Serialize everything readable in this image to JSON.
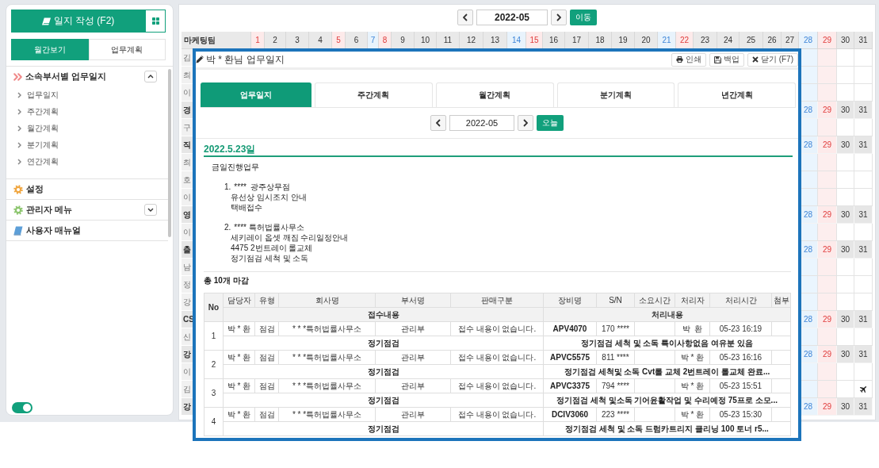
{
  "sidebar": {
    "write_button": {
      "label": "일지 작성 (F2)"
    },
    "view_tabs": [
      {
        "label": "월간보기",
        "selected": true
      },
      {
        "label": "업무계획",
        "selected": false
      }
    ],
    "menu": [
      {
        "kind": "journal",
        "label": "소속부서별 업무일지",
        "expanded": true,
        "children": [
          {
            "label": "업무일지"
          },
          {
            "label": "주간계획"
          },
          {
            "label": "월간계획"
          },
          {
            "label": "분기계획"
          },
          {
            "label": "연간계획"
          }
        ]
      },
      {
        "kind": "settings",
        "label": "설정"
      },
      {
        "kind": "admin",
        "label": "관리자 메뉴",
        "expanded": false
      },
      {
        "kind": "manual",
        "label": "사용자 매뉴얼"
      }
    ],
    "toggle": {
      "on": true
    }
  },
  "calendar": {
    "month": "2022-05",
    "go_button": "이동",
    "team": "마케팅팀",
    "days": [
      {
        "label": "1",
        "kind": "holiday"
      },
      {
        "label": "2",
        "kind": "weekday"
      },
      {
        "label": "3",
        "kind": "weekday"
      },
      {
        "label": "4",
        "kind": "weekday"
      },
      {
        "label": "5",
        "kind": "holiday"
      },
      {
        "label": "6",
        "kind": "weekday"
      },
      {
        "label": "7",
        "kind": "saturday"
      },
      {
        "label": "8",
        "kind": "holiday"
      },
      {
        "label": "9",
        "kind": "weekday"
      },
      {
        "label": "10",
        "kind": "weekday"
      },
      {
        "label": "11",
        "kind": "weekday"
      },
      {
        "label": "12",
        "kind": "weekday"
      },
      {
        "label": "13",
        "kind": "weekday"
      },
      {
        "label": "14",
        "kind": "saturday"
      },
      {
        "label": "15",
        "kind": "holiday"
      },
      {
        "label": "16",
        "kind": "weekday"
      },
      {
        "label": "17",
        "kind": "weekday"
      },
      {
        "label": "18",
        "kind": "weekday"
      },
      {
        "label": "19",
        "kind": "weekday"
      },
      {
        "label": "20",
        "kind": "weekday"
      },
      {
        "label": "21",
        "kind": "saturday"
      },
      {
        "label": "22",
        "kind": "holiday"
      },
      {
        "label": "23",
        "kind": "weekday"
      },
      {
        "label": "24",
        "kind": "weekday"
      },
      {
        "label": "25",
        "kind": "weekday"
      },
      {
        "label": "26",
        "kind": "weekday"
      },
      {
        "label": "27",
        "kind": "weekday"
      },
      {
        "label": "28",
        "kind": "saturday"
      },
      {
        "label": "29",
        "kind": "holiday"
      },
      {
        "label": "30",
        "kind": "weekday"
      },
      {
        "label": "31",
        "kind": "weekday"
      }
    ],
    "rows": [
      {
        "name": "김",
        "kind": "member",
        "cells": [
          {
            "trip": false
          },
          {
            "trip": false
          },
          {
            "trip": false
          },
          {
            "trip": false
          }
        ]
      },
      {
        "name": "최",
        "kind": "member",
        "cells": [
          {
            "trip": false
          },
          {
            "trip": false
          },
          {
            "trip": false
          },
          {
            "trip": false
          }
        ]
      },
      {
        "name": "이",
        "kind": "member",
        "cells": [
          {
            "trip": false
          },
          {
            "trip": false
          },
          {
            "trip": false
          },
          {
            "trip": false
          }
        ]
      },
      {
        "name": "경",
        "kind": "team",
        "cells": [
          {
            "text": "28"
          },
          {
            "text": "29"
          },
          {
            "text": "30"
          },
          {
            "text": "31"
          }
        ]
      },
      {
        "name": "구",
        "kind": "member",
        "cells": [
          {
            "trip": false
          },
          {
            "trip": false
          },
          {
            "trip": false
          },
          {
            "trip": false
          }
        ]
      },
      {
        "name": "직",
        "kind": "team",
        "cells": [
          {
            "text": "28"
          },
          {
            "text": "29"
          },
          {
            "text": "30"
          },
          {
            "text": "31"
          }
        ]
      },
      {
        "name": "최",
        "kind": "member",
        "cells": [
          {
            "trip": false
          },
          {
            "trip": false
          },
          {
            "trip": false
          },
          {
            "trip": false
          }
        ]
      },
      {
        "name": "호",
        "kind": "member",
        "cells": [
          {
            "trip": false
          },
          {
            "trip": false
          },
          {
            "trip": false
          },
          {
            "trip": false
          }
        ]
      },
      {
        "name": "이",
        "kind": "member",
        "cells": [
          {
            "trip": false
          },
          {
            "trip": false
          },
          {
            "trip": false
          },
          {
            "trip": false
          }
        ]
      },
      {
        "name": "영",
        "kind": "team",
        "cells": [
          {
            "text": "28"
          },
          {
            "text": "29"
          },
          {
            "text": "30"
          },
          {
            "text": "31"
          }
        ]
      },
      {
        "name": "이",
        "kind": "member",
        "cells": [
          {
            "trip": false
          },
          {
            "trip": false
          },
          {
            "trip": false
          },
          {
            "trip": false
          }
        ]
      },
      {
        "name": "출",
        "kind": "team",
        "cells": [
          {
            "text": "28"
          },
          {
            "text": "29"
          },
          {
            "text": "30"
          },
          {
            "text": "31"
          }
        ]
      },
      {
        "name": "남",
        "kind": "member",
        "cells": [
          {
            "trip": false
          },
          {
            "trip": false
          },
          {
            "trip": false
          },
          {
            "trip": false
          }
        ]
      },
      {
        "name": "정",
        "kind": "member",
        "cells": [
          {
            "trip": false
          },
          {
            "trip": false
          },
          {
            "trip": false
          },
          {
            "trip": false
          }
        ]
      },
      {
        "name": "강",
        "kind": "member",
        "cells": [
          {
            "trip": false
          },
          {
            "trip": false
          },
          {
            "trip": false
          },
          {
            "trip": false
          }
        ]
      },
      {
        "name": "CS",
        "kind": "team",
        "cells": [
          {
            "text": "28"
          },
          {
            "text": "29"
          },
          {
            "text": "30"
          },
          {
            "text": "31"
          }
        ]
      },
      {
        "name": "신",
        "kind": "member",
        "cells": [
          {
            "trip": false
          },
          {
            "trip": false
          },
          {
            "trip": false
          },
          {
            "trip": false
          }
        ]
      },
      {
        "name": "강",
        "kind": "team",
        "cells": [
          {
            "text": "28"
          },
          {
            "text": "29"
          },
          {
            "text": "30"
          },
          {
            "text": "31"
          }
        ]
      },
      {
        "name": "이",
        "kind": "member",
        "cells": [
          {
            "trip": false
          },
          {
            "trip": false
          },
          {
            "trip": false
          },
          {
            "trip": false
          }
        ]
      },
      {
        "name": "김",
        "kind": "member",
        "cells": [
          {
            "trip": false
          },
          {
            "trip": false
          },
          {
            "trip": false
          },
          {
            "trip": true
          }
        ]
      },
      {
        "name": "강",
        "kind": "team",
        "cells": [
          {
            "text": "28"
          },
          {
            "text": "29"
          },
          {
            "text": "30"
          },
          {
            "text": "31"
          }
        ]
      }
    ]
  },
  "modal": {
    "title": "박 * 환님 업무일지",
    "actions": [
      {
        "kind": "print",
        "label": "인쇄"
      },
      {
        "kind": "backup",
        "label": "백업"
      },
      {
        "kind": "close",
        "label": "닫기 (F7)"
      }
    ],
    "tabs": [
      {
        "label": "업무일지",
        "selected": true
      },
      {
        "label": "주간계획",
        "selected": false
      },
      {
        "label": "월간계획",
        "selected": false
      },
      {
        "label": "분기계획",
        "selected": false
      },
      {
        "label": "년간계획",
        "selected": false
      }
    ],
    "month": "2022-05",
    "today_button": "오늘",
    "date_heading": "2022.5.23일",
    "report": {
      "heading": "금일진행업무",
      "items": [
        {
          "number": "1.",
          "title": "****  광주상무점",
          "lines": [
            "유선상 임시조치 안내",
            "택배접수"
          ]
        },
        {
          "number": "2.",
          "title": "**** 특허법률사무소",
          "lines": [
            "세키레이 옵셋 깨짐 수리일정안내",
            "4475 2번트레이 롤교체",
            "정기점검 세척 및 소독"
          ]
        }
      ]
    },
    "summary": "총 10개 마감",
    "table": {
      "columns": [
        "No",
        "담당자",
        "유형",
        "회사명",
        "부서명",
        "판매구분",
        "장비명",
        "S/N",
        "소요시간",
        "처리자",
        "처리시간",
        "첨부"
      ],
      "groups": [
        "접수내용",
        "처리내용"
      ],
      "records": [
        {
          "no": "1",
          "manager": "박 * 환",
          "type": "점검",
          "company": "* * *특허법률사무소",
          "department": "관리부",
          "sales_type": "접수 내용이 없습니다.",
          "equipment": "APV4070",
          "serial": "170 ****",
          "handler": "박  환",
          "handled_at": "05-23 16:19",
          "received": "정기점검",
          "processed": "정기점검 세척 및 소독 특이사항없음 여유분 있음"
        },
        {
          "no": "2",
          "manager": "박 * 환",
          "type": "점검",
          "company": "* * *특허법률사무소",
          "department": "관리부",
          "sales_type": "접수 내용이 없습니다.",
          "equipment": "APVC5575",
          "serial": "811 ****",
          "handler": "박 * 환",
          "handled_at": "05-23 16:16",
          "received": "정기점검",
          "processed": "정기점검 세척및 소독 Cvt롤 교체 2번트레이 롤교체 완료..."
        },
        {
          "no": "3",
          "manager": "박 * 환",
          "type": "점검",
          "company": "* * *특허법률사무소",
          "department": "관리부",
          "sales_type": "접수 내용이 없습니다.",
          "equipment": "APVC3375",
          "serial": "794 ****",
          "handler": "박 * 환",
          "handled_at": "05-23 15:51",
          "received": "정기점검",
          "processed": "정기점검 세척 및소독 기어윤활작업 및 수리예정 75프로 소모..."
        },
        {
          "no": "4",
          "manager": "박 * 환",
          "type": "점검",
          "company": "* * *특허법률사무소",
          "department": "관리부",
          "sales_type": "접수 내용이 없습니다.",
          "equipment": "DCIV3060",
          "serial": "223 ****",
          "handler": "박 * 환",
          "handled_at": "05-23 15:30",
          "received": "정기점검",
          "processed": "정기점검 세척 및 소독 드럼카트리지 클리닝 100 토너 r5..."
        }
      ]
    }
  }
}
